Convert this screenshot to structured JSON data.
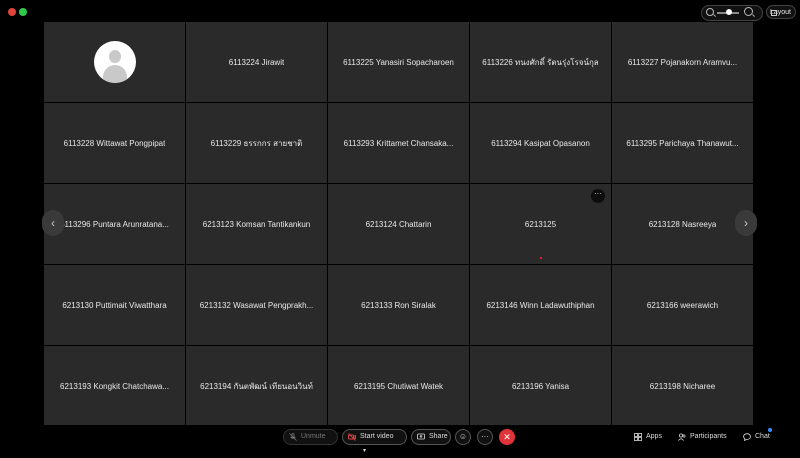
{
  "window": {
    "layout_label": "Layout"
  },
  "participants": [
    {
      "name": "",
      "avatar": true
    },
    {
      "name": "6113224 Jirawit"
    },
    {
      "name": "6113225 Yanasiri Sopacharoen"
    },
    {
      "name": "6113226 ทนงศักดิ์ รัตนรุ่งโรจน์กุล"
    },
    {
      "name": "6113227 Pojanakorn Aramvu..."
    },
    {
      "name": "6113228 Wittawat Pongpipat"
    },
    {
      "name": "6113229 ธรรกกร สายชาติ"
    },
    {
      "name": "6113293 Krittamet Chansaka..."
    },
    {
      "name": "6113294 Kasipat Opasanon"
    },
    {
      "name": "6113295 Parichaya Thanawut..."
    },
    {
      "name": "6113296 Puntara Arunratana..."
    },
    {
      "name": "6213123 Komsan Tantikankun"
    },
    {
      "name": "6213124 Chattarin"
    },
    {
      "name": "6213125",
      "more": true
    },
    {
      "name": "6213128 Nasreeya"
    },
    {
      "name": "6213130 Puttimait Viwatthara"
    },
    {
      "name": "6213132 Wasawat Pengprakh..."
    },
    {
      "name": "6213133 Ron Siralak"
    },
    {
      "name": "6213146 Winn Ladawuthiphan"
    },
    {
      "name": "6213166 weerawich"
    },
    {
      "name": "6213193 Kongkit Chatchawa..."
    },
    {
      "name": "6213194 กันตพัฒน์ เทียนอนวินท์"
    },
    {
      "name": "6213195 Chutiwat Watek"
    },
    {
      "name": "6213196 Yanisa"
    },
    {
      "name": "6213198 Nicharee"
    }
  ],
  "controls": {
    "unmute": "Unmute",
    "start_video": "Start video",
    "share": "Share",
    "more": "···",
    "leave": "✕",
    "apps": "Apps",
    "participants": "Participants",
    "chat": "Chat"
  },
  "colors": {
    "leave": "#e0343a",
    "tile": "#2a2a2a",
    "chat_badge": "#3b8cff"
  }
}
